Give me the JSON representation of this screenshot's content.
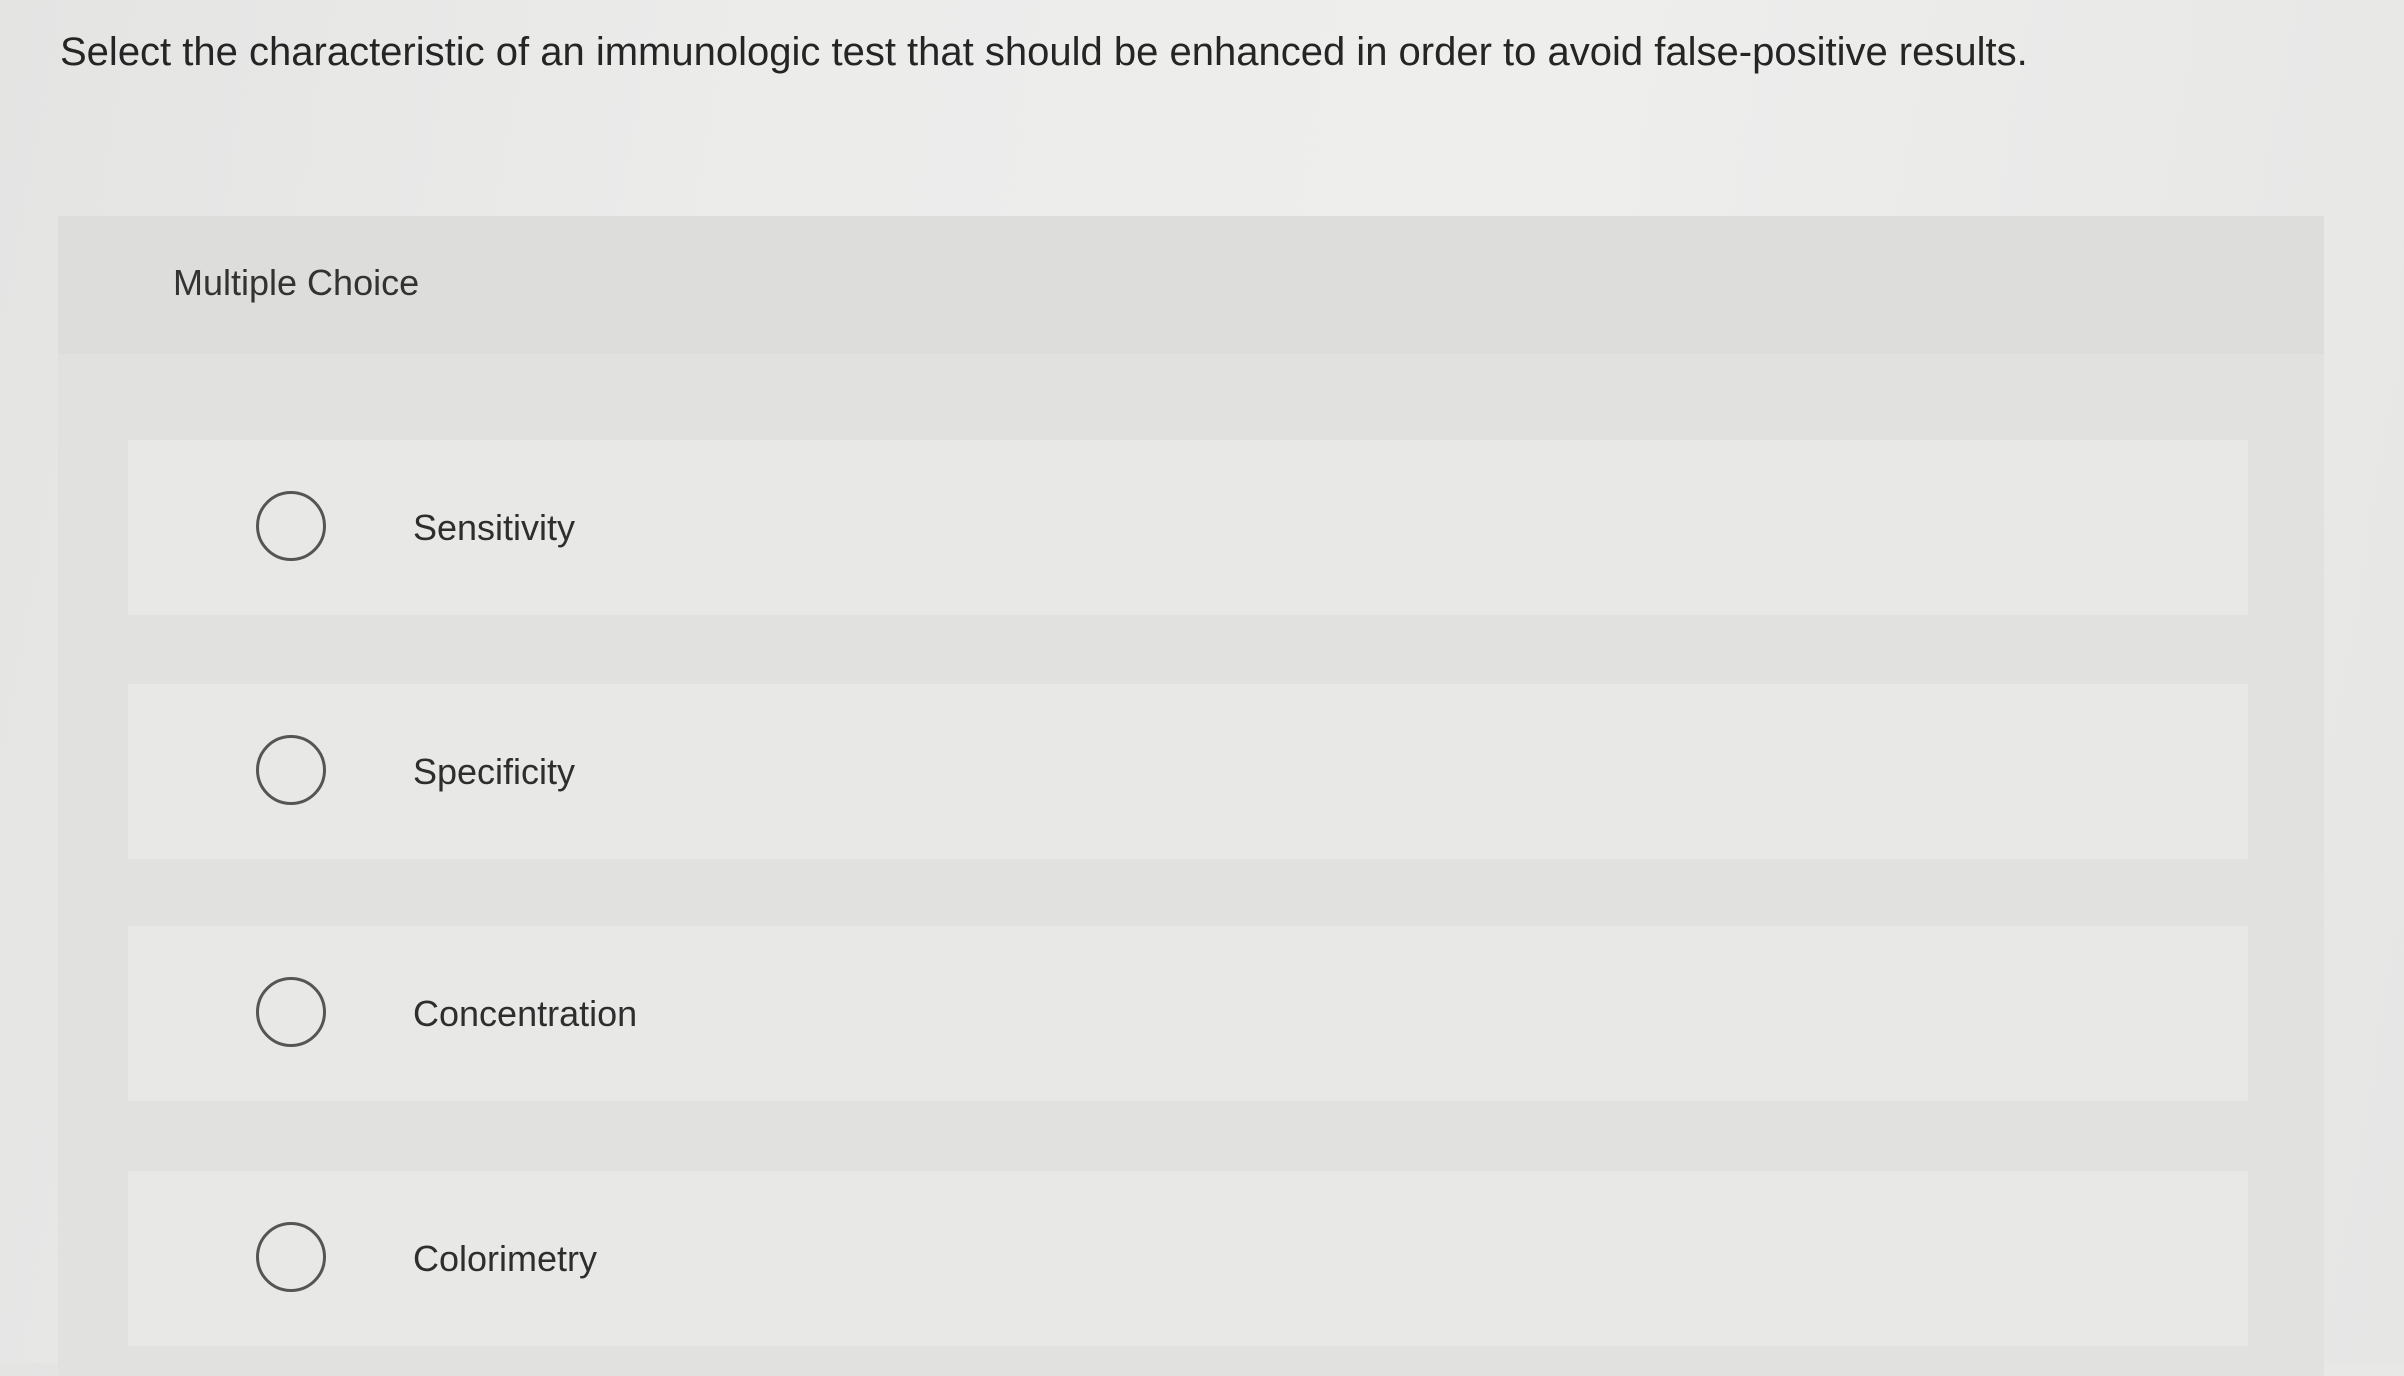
{
  "question": {
    "text": "Select the characteristic of an immunologic test that should be enhanced in order to avoid false-positive results."
  },
  "multiple_choice": {
    "label": "Multiple Choice",
    "options": [
      {
        "label": "Sensitivity",
        "selected": false
      },
      {
        "label": "Specificity",
        "selected": false
      },
      {
        "label": "Concentration",
        "selected": false
      },
      {
        "label": "Colorimetry",
        "selected": false
      }
    ]
  }
}
